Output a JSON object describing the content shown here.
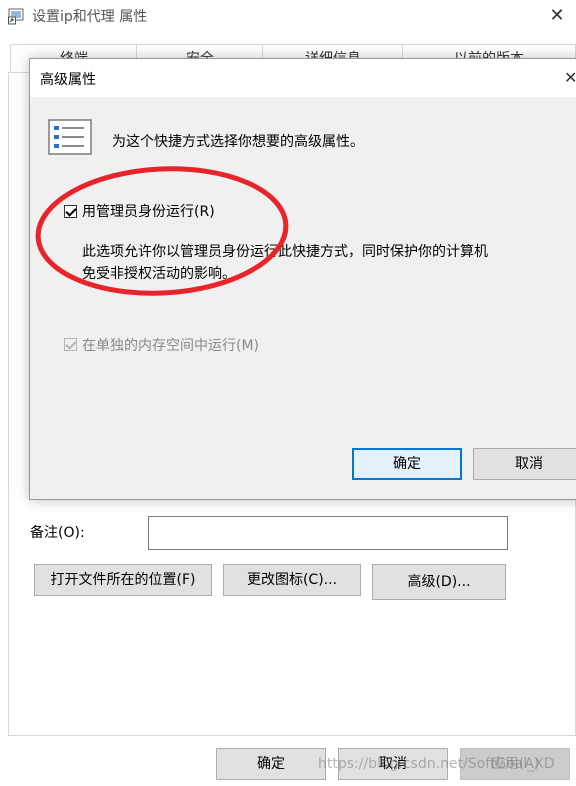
{
  "main_window": {
    "title": "设置ip和代理 属性",
    "tabs": [
      "终端",
      "安全",
      "详细信息",
      "以前的版本"
    ],
    "comment_label": "备注(O):",
    "comment_value": "",
    "buttons": {
      "open_location": "打开文件所在的位置(F)",
      "change_icon": "更改图标(C)...",
      "advanced": "高级(D)...",
      "ok": "确定",
      "cancel": "取消",
      "apply": "应用(A)"
    },
    "watermark": "https://blog.csdn.net/SoftGoal_XD"
  },
  "dialog": {
    "title": "高级属性",
    "intro": "为这个快捷方式选择你想要的高级属性。",
    "run_as_admin": {
      "label": "用管理员身份运行(R)",
      "checked": true,
      "description_line1": "此选项允许你以管理员身份运行此快捷方式，同时保护你的计算机",
      "description_line2": "免受非授权活动的影响。"
    },
    "separate_memory": {
      "label": "在单独的内存空间中运行(M)",
      "checked": true,
      "disabled": true
    },
    "ok": "确定",
    "cancel": "取消"
  },
  "colors": {
    "annotation_circle": "#e8242b",
    "focus_border": "#0078d7",
    "icon_blue": "#2b6fd6"
  }
}
